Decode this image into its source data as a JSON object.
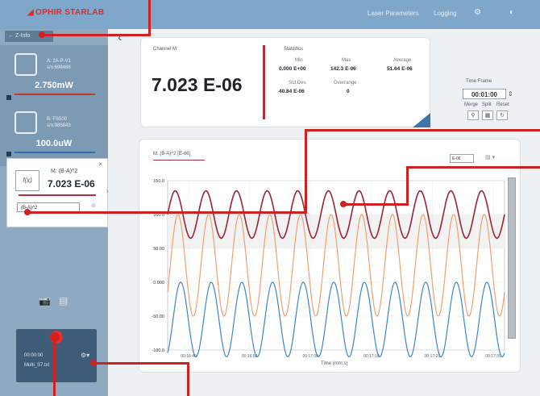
{
  "topbar": {
    "logo": "OPHIR STARLAB",
    "menu_1": "Laser Parameters",
    "menu_2": "Logging",
    "menu_3": "⚙",
    "menu_4": "◐"
  },
  "sidebar": {
    "header": "← Z-Info",
    "sensors": [
      {
        "name_line1": "A: 2A-P-V1",
        "name_line2": "s/n:698488",
        "value": "2.750mW",
        "bar_color": "#c0392b"
      },
      {
        "name_line1": "B: FS500",
        "name_line2": "s/n:985843",
        "value": "100.0uW",
        "bar_color": "#2e6db4"
      }
    ],
    "math_channel": {
      "icon_label": "f(x)",
      "title": "M: (B-A)^2",
      "value": "7.023 E-06",
      "formula": "(B-A)^2",
      "close": "×"
    },
    "recorder": {
      "time": "00:00:00",
      "filename": "Multi_S7.txt"
    }
  },
  "stats": {
    "channel_name": "Channel M",
    "big_value": "7.023 E-06",
    "title": "Statistics",
    "min_label": "Min",
    "min_value": "0.000 E+00",
    "max_label": "Max",
    "max_value": "142.3 E-06",
    "avg_label": "Average",
    "avg_value": "51.64 E-06",
    "std_label": "Std.Dev.",
    "std_value": "40.84 E-06",
    "over_label": "Overrange",
    "over_value": "0"
  },
  "timeframe": {
    "label": "Time Frame",
    "value": "00:01:00",
    "merge": "Merge",
    "split": "Split",
    "reset": "Reset"
  },
  "chart_data": {
    "type": "line",
    "title": "M: (B-A)^2 [E-06]",
    "units_select": "E-06",
    "xlabel": "Time (mm:s)",
    "x": [
      "00:16:40",
      "00:16:50",
      "00:17:00",
      "00:17:10",
      "00:17:20",
      "00:17:30"
    ],
    "ylim": [
      -100.0,
      150.0
    ],
    "ytick_labels": [
      "150.0",
      "100.0",
      "50.00",
      "0.000",
      "-50.00",
      "-100.0"
    ],
    "series_colors": [
      "#9b2335",
      "#f0a070",
      "#3a86c8"
    ],
    "series": [
      {
        "amplitude": 35,
        "offset": 100
      },
      {
        "amplitude": 75,
        "offset": 25
      },
      {
        "amplitude": 55,
        "offset": -55
      }
    ]
  },
  "callouts": {
    "color": "#d02020"
  }
}
